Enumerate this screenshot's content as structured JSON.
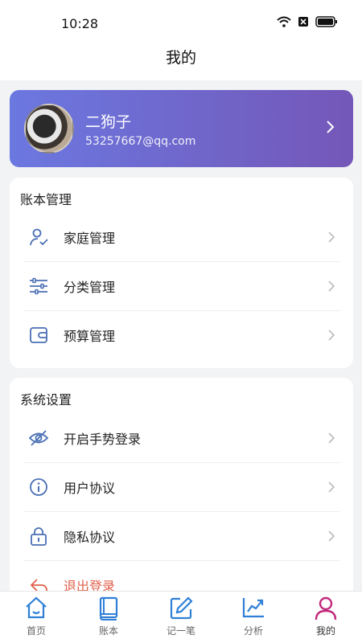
{
  "status_bar": {
    "time": "10:28"
  },
  "header": {
    "title": "我的"
  },
  "profile": {
    "name": "二狗子",
    "email": "53257667@qq.com"
  },
  "book_section": {
    "title": "账本管理",
    "items": [
      {
        "label": "家庭管理",
        "icon": "user-check-icon"
      },
      {
        "label": "分类管理",
        "icon": "sliders-icon"
      },
      {
        "label": "预算管理",
        "icon": "wallet-icon"
      }
    ]
  },
  "system_section": {
    "title": "系统设置",
    "items": [
      {
        "label": "开启手势登录",
        "icon": "eye-off-icon"
      },
      {
        "label": "用户协议",
        "icon": "info-icon"
      },
      {
        "label": "隐私协议",
        "icon": "lock-icon"
      },
      {
        "label": "退出登录",
        "icon": "logout-icon"
      }
    ]
  },
  "tabbar": {
    "items": [
      {
        "label": "首页",
        "icon": "home-icon"
      },
      {
        "label": "账本",
        "icon": "book-icon"
      },
      {
        "label": "记一笔",
        "icon": "edit-icon"
      },
      {
        "label": "分析",
        "icon": "chart-icon"
      },
      {
        "label": "我的",
        "icon": "user-icon",
        "active": true
      }
    ]
  },
  "colors": {
    "accent_blue": "#2f7fd6",
    "icon_blue": "#4a6fb5",
    "active_pink": "#c0287a",
    "logout_red": "#e0604a",
    "card_gradient_start": "#6b78e0",
    "card_gradient_end": "#7457b8"
  }
}
